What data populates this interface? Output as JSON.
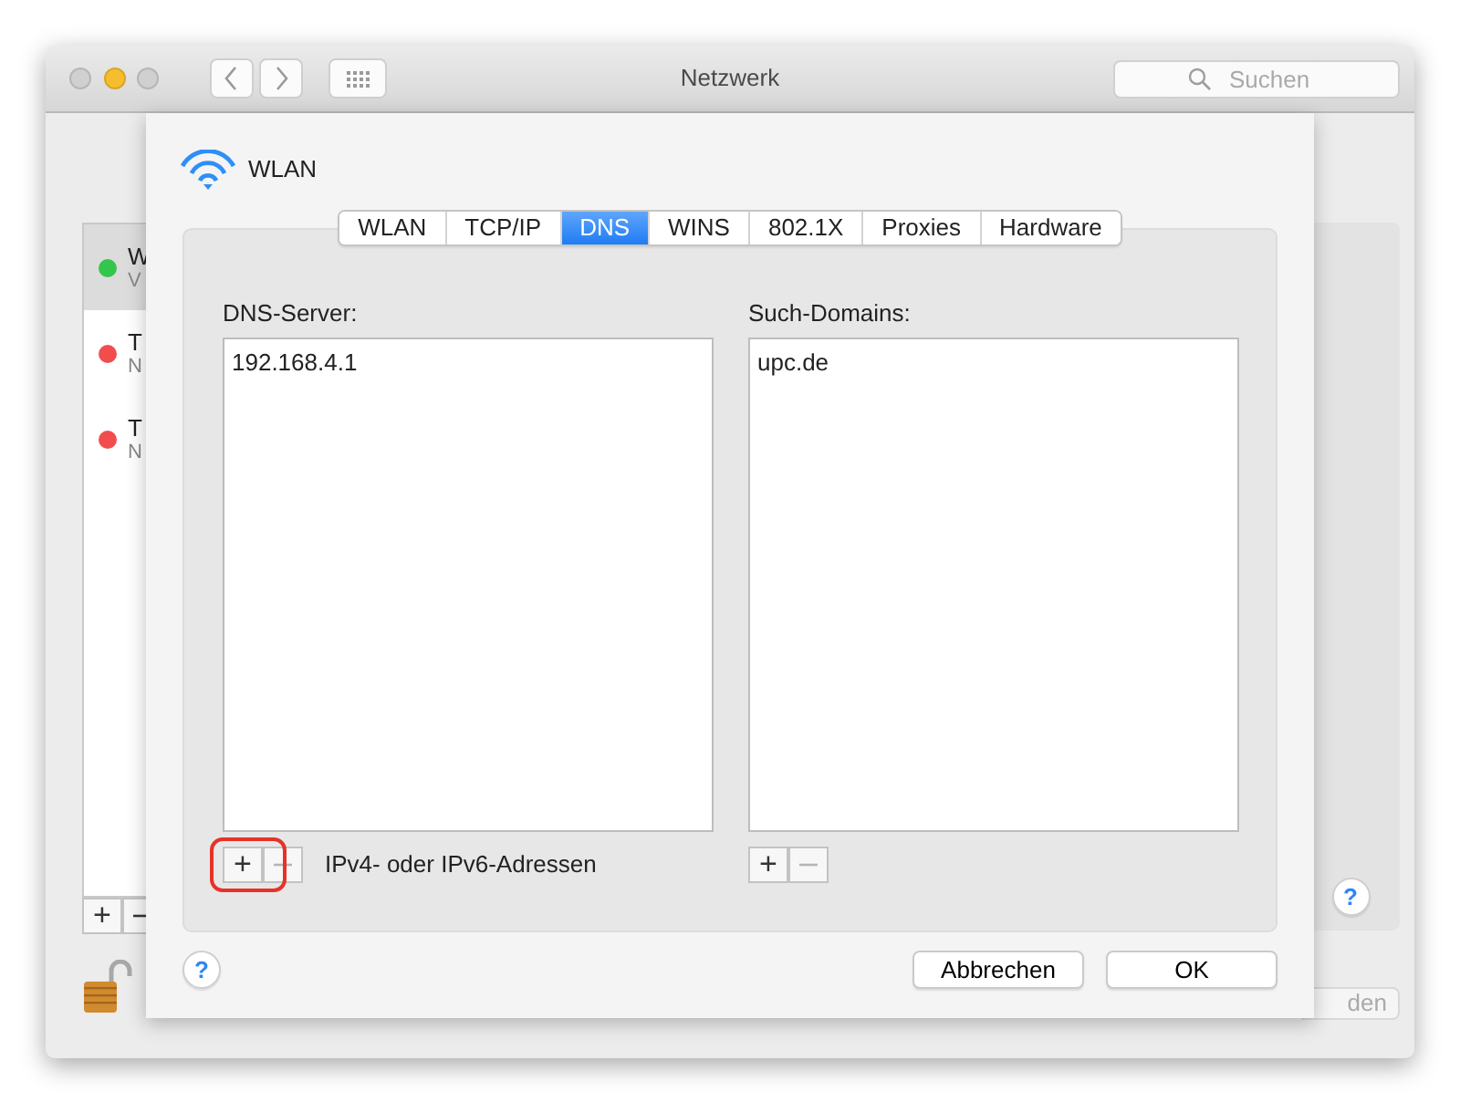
{
  "window": {
    "title": "Netzwerk",
    "search": {
      "placeholder": "Suchen"
    }
  },
  "background": {
    "services": [
      {
        "name": "W",
        "detail": "V",
        "color": "#34c64a",
        "selected": true
      },
      {
        "name": "T",
        "detail": "N",
        "color": "#f24d4d",
        "selected": false
      },
      {
        "name": "T",
        "detail": "N",
        "color": "#f24d4d",
        "selected": false
      }
    ],
    "add_button": "+",
    "help": "?",
    "partial_button": "den"
  },
  "sheet": {
    "title": "WLAN",
    "tabs": [
      {
        "label": "WLAN",
        "selected": false
      },
      {
        "label": "TCP/IP",
        "selected": false
      },
      {
        "label": "DNS",
        "selected": true
      },
      {
        "label": "WINS",
        "selected": false
      },
      {
        "label": "802.1X",
        "selected": false
      },
      {
        "label": "Proxies",
        "selected": false
      },
      {
        "label": "Hardware",
        "selected": false
      }
    ],
    "columns": [
      {
        "label": "DNS-Server:",
        "entries": [
          "192.168.4.1"
        ],
        "buttons": [
          {
            "kind": "add",
            "symbol": "+",
            "disabled": false,
            "highlighted": true
          },
          {
            "kind": "remove",
            "disabled": true,
            "highlighted": false
          }
        ],
        "hint": "IPv4- oder IPv6-Adressen"
      },
      {
        "label": "Such-Domains:",
        "entries": [
          "upc.de"
        ],
        "buttons": [
          {
            "kind": "add",
            "symbol": "+",
            "disabled": false,
            "highlighted": false
          },
          {
            "kind": "remove",
            "disabled": true,
            "highlighted": false
          }
        ]
      }
    ],
    "help": "?",
    "buttons": [
      "Abbrechen",
      "OK"
    ]
  }
}
